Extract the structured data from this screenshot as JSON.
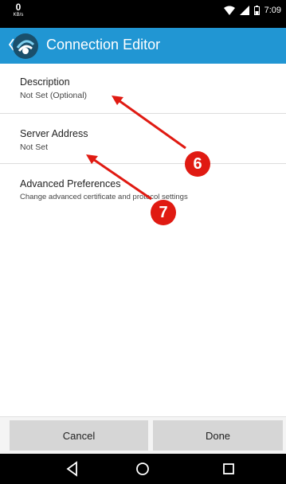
{
  "status_bar": {
    "net_speed_value": "0",
    "net_speed_unit": "KB/s",
    "time": "7:09",
    "icons": [
      "wifi-icon",
      "cell-signal-icon",
      "battery-icon"
    ]
  },
  "app_bar": {
    "title": "Connection Editor",
    "icons": [
      "back-chevron-icon",
      "app-logo-icon"
    ],
    "color": "#2196d3"
  },
  "preferences": [
    {
      "title": "Description",
      "summary": "Not Set (Optional)"
    },
    {
      "title": "Server Address",
      "summary": "Not Set"
    },
    {
      "title": "Advanced Preferences",
      "summary": "Change advanced certificate and protocol settings"
    }
  ],
  "annotations": {
    "badges": [
      "6",
      "7"
    ],
    "color": "#e01a12"
  },
  "buttons": {
    "cancel": "Cancel",
    "done": "Done"
  },
  "nav_bar": {
    "icons": [
      "nav-back-icon",
      "nav-home-icon",
      "nav-recents-icon"
    ]
  }
}
